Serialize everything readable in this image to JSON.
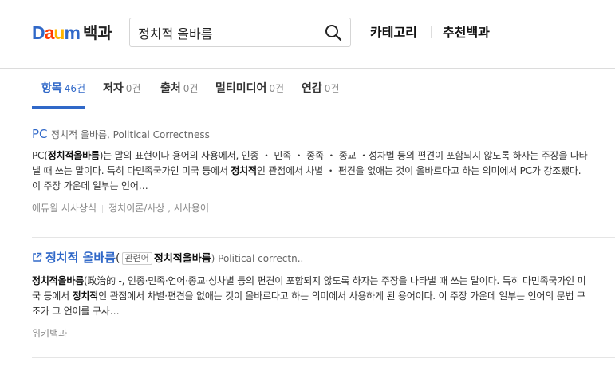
{
  "header": {
    "logo_letters": [
      "D",
      "a",
      "u",
      "m"
    ],
    "logo_colors": [
      "#3068c8",
      "#ff3c00",
      "#ffb400",
      "#3068c8"
    ],
    "service_name": "백과",
    "search": {
      "value": "정치적 올바름",
      "icon": "search-icon"
    },
    "nav": [
      "카테고리",
      "추천백과"
    ]
  },
  "tabs": [
    {
      "label": "항목",
      "count": "46건",
      "active": true
    },
    {
      "label": "저자",
      "count": "0건",
      "active": false
    },
    {
      "label": "출처",
      "count": "0건",
      "active": false
    },
    {
      "label": "멀티미디어",
      "count": "0건",
      "active": false
    },
    {
      "label": "연감",
      "count": "0건",
      "active": false
    }
  ],
  "results": [
    {
      "title": "PC",
      "subtitle": "정치적 올바름, Political Correctness",
      "desc_parts": [
        {
          "t": "PC("
        },
        {
          "t": "정치적올바름",
          "b": true
        },
        {
          "t": ")는 말의 표현이나 용어의 사용에서, 인종 ・ 민족 ・ 종족 ・ 종교 ・성차별 등의 편견이 포함되지 않도록 하자는 주장을 나타낼 때 쓰는 말이다. 특히 다민족국가인 미국 등에서 "
        },
        {
          "t": "정치적",
          "b": true
        },
        {
          "t": "인 관점에서 차별 ・ 편견을 없애는 것이 올바르다고 하는 의미에서 PC가 강조됐다. 이 주장 가운데 일부는 언어…"
        }
      ],
      "source": "에듀윌 시사상식",
      "category": "정치이론/사상 , 시사용어"
    },
    {
      "title": "정치적 올바름",
      "title_suffix": "(",
      "tag": "관련어",
      "related": "정치적올바름",
      "subtitle": ") Political correctn..",
      "desc_parts": [
        {
          "t": "정치적올바름",
          "b": true
        },
        {
          "t": "(政治的 -, 인종·민족·언어·종교·성차별 등의 편견이 포함되지 않도록 하자는 주장을 나타낼 때 쓰는 말이다. 특히 다민족국가인 미국 등에서 "
        },
        {
          "t": "정치적",
          "b": true
        },
        {
          "t": "인 관점에서 차별·편견을 없애는 것이 올바르다고 하는 의미에서 사용하게 된 용어이다. 이 주장 가운데 일부는 언어의 문법 구조가 그 언어를 구사…"
        }
      ],
      "source": "위키백과"
    }
  ]
}
